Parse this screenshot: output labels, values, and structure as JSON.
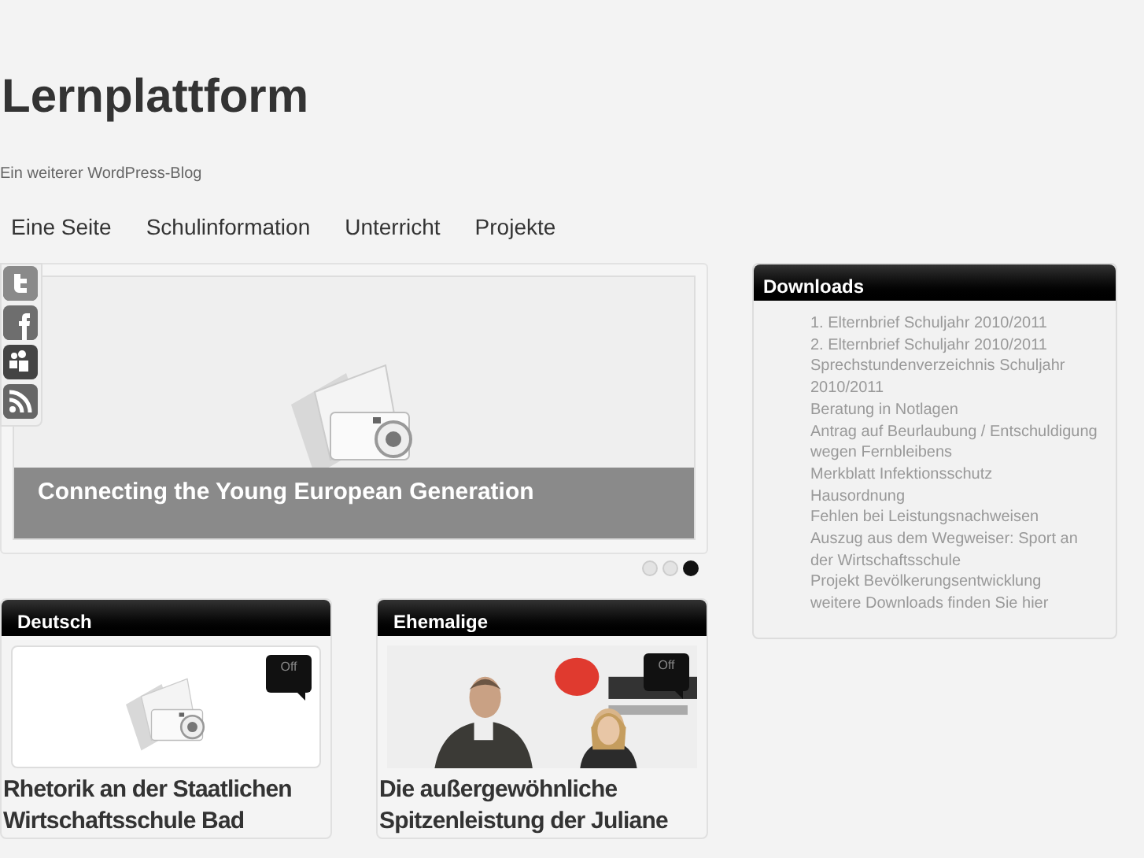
{
  "site": {
    "title": "Lernplattform",
    "tagline": "Ein weiterer WordPress-Blog"
  },
  "nav": [
    "Eine Seite",
    "Schulinformation",
    "Unterricht",
    "Projekte"
  ],
  "social": [
    {
      "kind": "twitter"
    },
    {
      "kind": "facebook"
    },
    {
      "kind": "myspace"
    },
    {
      "kind": "rss"
    }
  ],
  "slider": {
    "caption": "Connecting the Young European Generation",
    "dots": [
      {
        "selected": false
      },
      {
        "selected": false
      },
      {
        "selected": true
      }
    ]
  },
  "downloads": {
    "title": "Downloads",
    "items": [
      "1. Elternbrief Schuljahr 2010/2011",
      "2. Elternbrief Schuljahr 2010/2011",
      "Sprechstundenverzeichnis Schuljahr 2010/2011",
      "Beratung in Notlagen",
      "Antrag auf Beurlaubung / Entschuldigung wegen Fernbleibens",
      "Merkblatt Infektionsschutz",
      "Hausordnung",
      "Fehlen bei Leistungsnachweisen",
      "Auszug aus dem Wegweiser: Sport an der Wirtschaftsschule",
      "Projekt Bevölkerungsentwicklung",
      "weitere Downloads finden Sie hier"
    ]
  },
  "cards": [
    {
      "category": "Deutsch",
      "kind": "placeholder",
      "badge": "Off",
      "title": "Rhetorik an der Staatlichen Wirtschaftsschule Bad"
    },
    {
      "category": "Ehemalige",
      "kind": "picture",
      "badge": "Off",
      "title": "Die außergewöhnliche Spitzenleistung der Juliane"
    }
  ]
}
